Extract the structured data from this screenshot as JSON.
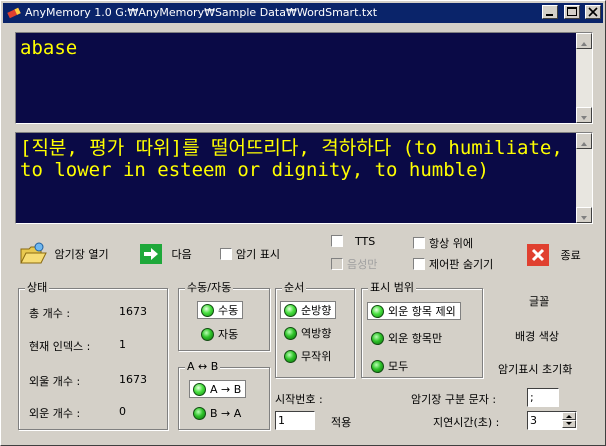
{
  "window": {
    "title": "AnyMemory 1.0    G:₩AnyMemory₩Sample Data₩WordSmart.txt",
    "minimize_glyph": "_",
    "maximize_glyph": "□",
    "close_glyph": "✕"
  },
  "display": {
    "question": "abase",
    "answer": "[직분, 평가 따위]를 떨어뜨리다, 격하하다 (to humiliate, to lower in esteem or dignity, to humble)"
  },
  "toolbar": {
    "open_label": "암기장 열기",
    "next_label": "다음",
    "show_memorize_label": "암기 표시",
    "tts_label": "TTS",
    "voice_only_label": "음성만",
    "always_on_top_label": "항상 위에",
    "hide_controls_label": "제어판 숨기기",
    "exit_label": "종료"
  },
  "status": {
    "title": "상태",
    "total_label": "총 개수 :",
    "total_value": "1673",
    "current_index_label": "현재 인덱스 :",
    "current_index_value": "1",
    "to_memorize_label": "외울 개수 :",
    "to_memorize_value": "1673",
    "memorized_label": "외운 개수 :",
    "memorized_value": "0"
  },
  "mode_group": {
    "title": "수동/자동",
    "options": [
      "수동",
      "자동"
    ],
    "selected": "수동"
  },
  "direction_group": {
    "title": "A ↔ B",
    "options": [
      "A → B",
      "B → A"
    ],
    "selected": "A → B"
  },
  "order_group": {
    "title": "순서",
    "options": [
      "순방향",
      "역방향",
      "무작위"
    ],
    "selected": "순방향"
  },
  "range_group": {
    "title": "표시 범위",
    "options": [
      "외운 항목 제외",
      "외운 항목만",
      "모두"
    ],
    "selected": "외운 항목 제외"
  },
  "right_panel": {
    "font_label": "글꼴",
    "bg_color_label": "배경 색상",
    "reset_memorize_label": "암기표시 초기화"
  },
  "bottom": {
    "start_number_label": "시작번호 :",
    "start_number_value": "1",
    "apply_label": "적용",
    "separator_label": "암기장 구분 문자 :",
    "separator_value": ";",
    "delay_label": "지연시간(초) :",
    "delay_value": "3"
  },
  "colors": {
    "title_bar": "#0a246a",
    "display_bg": "#0a0a46",
    "display_text": "#ffff00",
    "radio_green": "#2fc32a",
    "exit_red": "#e04030",
    "next_green": "#1ea83a"
  }
}
